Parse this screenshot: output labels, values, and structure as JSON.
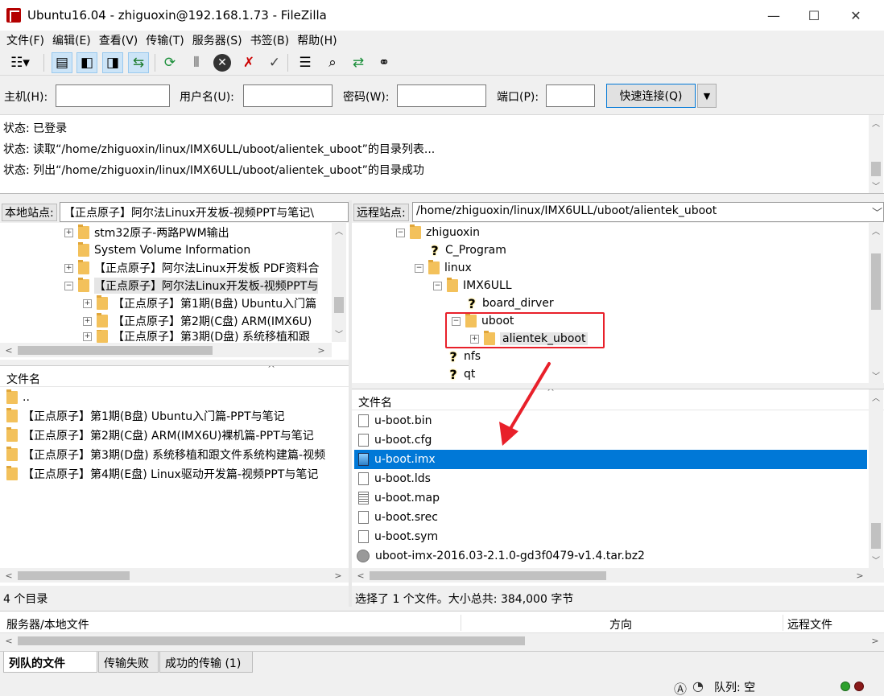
{
  "window": {
    "title": "Ubuntu16.04 - zhiguoxin@192.168.1.73 - FileZilla",
    "minimize": "—",
    "maximize": "☐",
    "close": "✕"
  },
  "menu": [
    "文件(F)",
    "编辑(E)",
    "查看(V)",
    "传输(T)",
    "服务器(S)",
    "书签(B)",
    "帮助(H)"
  ],
  "quickconnect": {
    "host_label": "主机(H):",
    "host_value": "",
    "user_label": "用户名(U):",
    "user_value": "",
    "pass_label": "密码(W):",
    "pass_value": "",
    "port_label": "端口(P):",
    "port_value": "",
    "connect_label": "快速连接(Q)"
  },
  "log": [
    "状态:  已登录",
    "状态:  读取“/home/zhiguoxin/linux/IMX6ULL/uboot/alientek_uboot”的目录列表...",
    "状态:  列出“/home/zhiguoxin/linux/IMX6ULL/uboot/alientek_uboot”的目录成功"
  ],
  "local": {
    "site_label": "本地站点:",
    "path": "【正点原子】阿尔法Linux开发板-视频PPT与笔记\\",
    "tree": [
      "stm32原子-两路PWM输出",
      "System Volume Information",
      "【正点原子】阿尔法Linux开发板 PDF资料合",
      "【正点原子】阿尔法Linux开发板-视频PPT与",
      "【正点原子】第1期(B盘) Ubuntu入门篇",
      "【正点原子】第2期(C盘) ARM(IMX6U)",
      "【正点原子】第3期(D盘) 系统移植和跟"
    ],
    "col_filename": "文件名",
    "files": [
      "..",
      "【正点原子】第1期(B盘) Ubuntu入门篇-PPT与笔记",
      "【正点原子】第2期(C盘) ARM(IMX6U)裸机篇-PPT与笔记",
      "【正点原子】第3期(D盘) 系统移植和跟文件系统构建篇-视频",
      "【正点原子】第4期(E盘) Linux驱动开发篇-视频PPT与笔记"
    ],
    "status": "4 个目录"
  },
  "remote": {
    "site_label": "远程站点:",
    "path": "/home/zhiguoxin/linux/IMX6ULL/uboot/alientek_uboot",
    "tree": [
      "zhiguoxin",
      "C_Program",
      "linux",
      "IMX6ULL",
      "board_dirver",
      "uboot",
      "alientek_uboot",
      "nfs",
      "qt"
    ],
    "col_filename": "文件名",
    "files": [
      "u-boot.bin",
      "u-boot.cfg",
      "u-boot.imx",
      "u-boot.lds",
      "u-boot.map",
      "u-boot.srec",
      "u-boot.sym",
      "uboot-imx-2016.03-2.1.0-gd3f0479-v1.4.tar.bz2"
    ],
    "selected_file": "u-boot.imx",
    "status": "选择了 1 个文件。大小总共: 384,000 字节"
  },
  "queue": {
    "col_server": "服务器/本地文件",
    "col_direction": "方向",
    "col_remote": "远程文件"
  },
  "tabs": [
    "列队的文件",
    "传输失败",
    "成功的传输 (1)"
  ],
  "bottom": {
    "queue_status": "队列: 空"
  },
  "colors": {
    "selection": "#0078d7",
    "annotation": "#e8202a"
  }
}
